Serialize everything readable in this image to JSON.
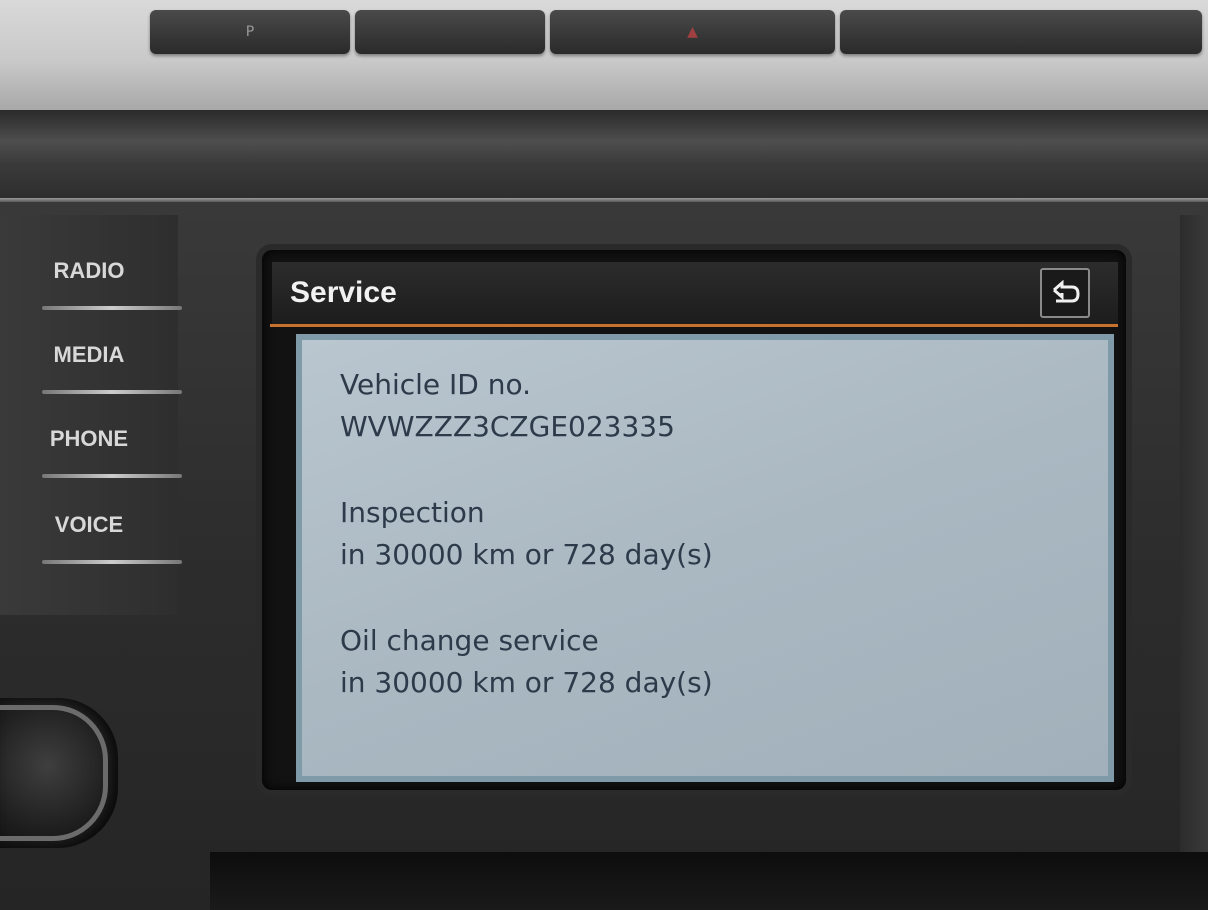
{
  "top_buttons": {
    "park_label": "P",
    "hazard_label": "",
    "other_label": ""
  },
  "side_buttons": [
    {
      "label": "RADIO"
    },
    {
      "label": "MEDIA"
    },
    {
      "label": "PHONE"
    },
    {
      "label": "VOICE"
    }
  ],
  "screen": {
    "title": "Service",
    "back_icon": "back-arrow-icon",
    "accent_color": "#c7712f",
    "vehicle_id_label": "Vehicle ID no.",
    "vehicle_id_value": "WVWZZZ3CZGE023335",
    "inspection_label": "Inspection",
    "inspection_value": "in 30000 km or 728 day(s)",
    "oil_label": "Oil change service",
    "oil_value": "in 30000 km or 728 day(s)"
  }
}
